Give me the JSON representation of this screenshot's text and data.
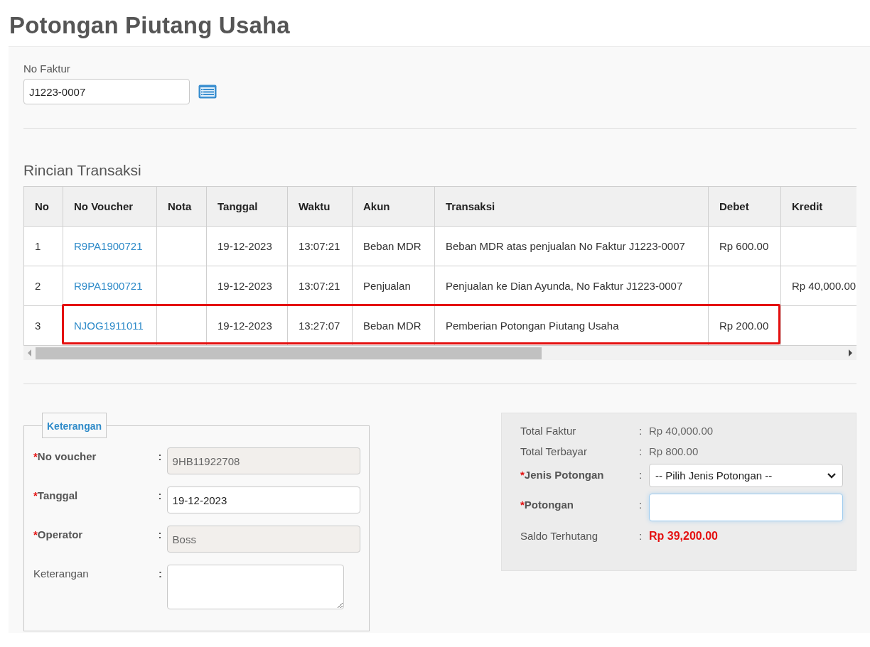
{
  "page_title": "Potongan Piutang Usaha",
  "invoice": {
    "label": "No Faktur",
    "value": "J1223-0007"
  },
  "transactions": {
    "title": "Rincian Transaksi",
    "columns": [
      "No",
      "No Voucher",
      "Nota",
      "Tanggal",
      "Waktu",
      "Akun",
      "Transaksi",
      "Debet",
      "Kredit"
    ],
    "rows": [
      {
        "no": "1",
        "voucher": "R9PA1900721",
        "nota": "",
        "date": "19-12-2023",
        "time": "13:07:21",
        "account": "Beban MDR",
        "description": "Beban MDR atas penjualan No Faktur J1223-0007",
        "debit": "Rp 600.00",
        "credit": "",
        "highlighted": false
      },
      {
        "no": "2",
        "voucher": "R9PA1900721",
        "nota": "",
        "date": "19-12-2023",
        "time": "13:07:21",
        "account": "Penjualan",
        "description": "Penjualan ke Dian Ayunda, No Faktur J1223-0007",
        "debit": "",
        "credit": "Rp 40,000.00",
        "highlighted": false
      },
      {
        "no": "3",
        "voucher": "NJOG1911011",
        "nota": "",
        "date": "19-12-2023",
        "time": "13:27:07",
        "account": "Beban MDR",
        "description": "Pemberian Potongan Piutang Usaha",
        "debit": "Rp 200.00",
        "credit": "",
        "highlighted": true
      }
    ]
  },
  "details": {
    "legend": "Keterangan",
    "fields": [
      {
        "kind": "input",
        "required_mark": "*",
        "label": "No voucher",
        "colon": ":",
        "value": "9HB11922708",
        "disabled": true
      },
      {
        "kind": "input",
        "required_mark": "*",
        "label": "Tanggal",
        "colon": ":",
        "value": "19-12-2023",
        "disabled": false
      },
      {
        "kind": "input",
        "required_mark": "*",
        "label": "Operator",
        "colon": ":",
        "value": "Boss",
        "disabled": true
      },
      {
        "kind": "textarea",
        "label": "Keterangan",
        "colon": ":",
        "disabled": false
      }
    ]
  },
  "summary": {
    "rows": [
      {
        "kind": "text",
        "label": "Total Faktur",
        "colon": ":",
        "value": "Rp 40,000.00",
        "emphasis": false
      },
      {
        "kind": "text",
        "label": "Total Terbayar",
        "colon": ":",
        "value": "Rp 800.00",
        "emphasis": false
      },
      {
        "kind": "select",
        "required_mark": "*",
        "label": "Jenis Potongan",
        "colon": ":",
        "value": "-- Pilih Jenis Potongan --"
      },
      {
        "kind": "input",
        "required_mark": "*",
        "label": "Potongan",
        "colon": ":",
        "focused": true
      },
      {
        "kind": "text",
        "label": "Saldo Terhutang",
        "colon": ":",
        "value": "Rp 39,200.00",
        "emphasis": true
      }
    ]
  }
}
